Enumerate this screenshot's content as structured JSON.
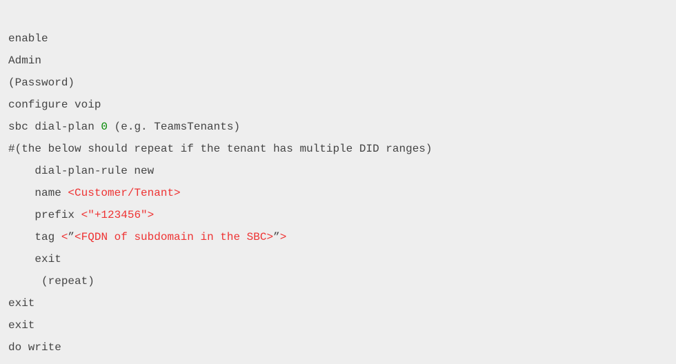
{
  "lines": {
    "l0": "enable",
    "l1": "Admin",
    "l2": "(Password)",
    "l3": "configure voip",
    "l4a": "sbc dial-plan ",
    "l4num": "0",
    "l4b": " (e.g. TeamsTenants)",
    "l5": "#(the below should repeat if the tenant has multiple DID ranges)",
    "l6": "dial-plan-rule new",
    "l7a": "name ",
    "l7r": "<Customer/Tenant>",
    "l8a": "prefix ",
    "l8r": "<\"+123456\">",
    "l9a": "tag ",
    "l9r1": "<",
    "l9b1": "”",
    "l9r2": "<FQDN of subdomain in the SBC>",
    "l9b2": "”",
    "l9r3": ">",
    "l10": "exit",
    "l11": " (repeat)",
    "l12": "exit",
    "l13": "exit",
    "l14": "do write"
  }
}
